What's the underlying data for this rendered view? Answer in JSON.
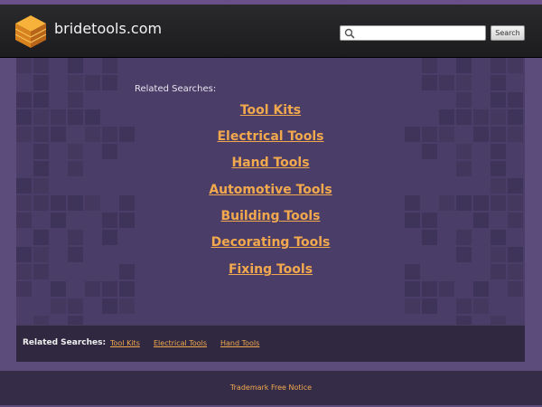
{
  "header": {
    "site_name": "bridetools.com",
    "search_placeholder": "",
    "search_button_label": "Search"
  },
  "main": {
    "related_label": "Related Searches:",
    "links": [
      "Tool Kits",
      "Electrical Tools",
      "Hand Tools",
      "Automotive Tools",
      "Building Tools",
      "Decorating Tools",
      "Fixing Tools"
    ]
  },
  "bottom_bar": {
    "label": "Related Searches:",
    "links": [
      "Tool Kits",
      "Electrical Tools",
      "Hand Tools"
    ]
  },
  "footer": {
    "trademark_link": "Trademark Free Notice"
  },
  "colors": {
    "link_orange": "#f2a94e",
    "panel_purple": "#4a3d67",
    "page_purple": "#5b4c7c",
    "header_dark": "#1c1c1e"
  }
}
